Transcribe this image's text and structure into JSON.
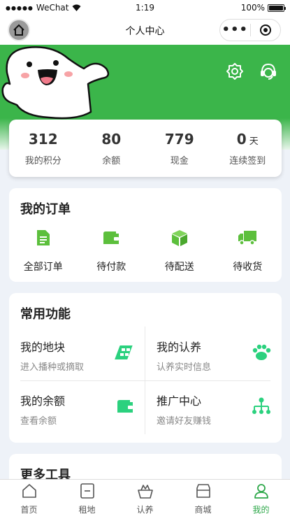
{
  "status_bar": {
    "carrier": "WeChat",
    "time": "1:19",
    "battery": "100%",
    "battery_level": 1.0
  },
  "nav": {
    "title": "个人中心",
    "more_glyph": "•••"
  },
  "stats": [
    {
      "value": "312",
      "unit": "",
      "label": "我的积分"
    },
    {
      "value": "80",
      "unit": "",
      "label": "余额"
    },
    {
      "value": "779",
      "unit": "",
      "label": "现金"
    },
    {
      "value": "0",
      "unit": "天",
      "label": "连续签到"
    }
  ],
  "orders": {
    "title": "我的订单",
    "items": [
      {
        "label": "全部订单",
        "icon": "document-icon"
      },
      {
        "label": "待付款",
        "icon": "wallet-icon"
      },
      {
        "label": "待配送",
        "icon": "box-icon"
      },
      {
        "label": "待收货",
        "icon": "truck-icon"
      }
    ]
  },
  "functions": {
    "title": "常用功能",
    "items": [
      {
        "name": "我的地块",
        "desc": "进入播种或摘取",
        "icon": "field-icon"
      },
      {
        "name": "我的认养",
        "desc": "认养实时信息",
        "icon": "paw-icon"
      },
      {
        "name": "我的余额",
        "desc": "查看余额",
        "icon": "wallet-icon"
      },
      {
        "name": "推广中心",
        "desc": "邀请好友赚钱",
        "icon": "network-icon"
      }
    ]
  },
  "more": {
    "title": "更多工具"
  },
  "tabs": [
    {
      "label": "首页",
      "icon": "home-icon",
      "active": false
    },
    {
      "label": "租地",
      "icon": "rent-icon",
      "active": false
    },
    {
      "label": "认养",
      "icon": "basket-icon",
      "active": false
    },
    {
      "label": "商城",
      "icon": "shop-icon",
      "active": false
    },
    {
      "label": "我的",
      "icon": "user-icon",
      "active": true
    }
  ],
  "colors": {
    "brand_green": "#3bb54a",
    "icon_green": "#5cbf3c",
    "func_green": "#2bd17e",
    "active_tab": "#2ea84a"
  }
}
